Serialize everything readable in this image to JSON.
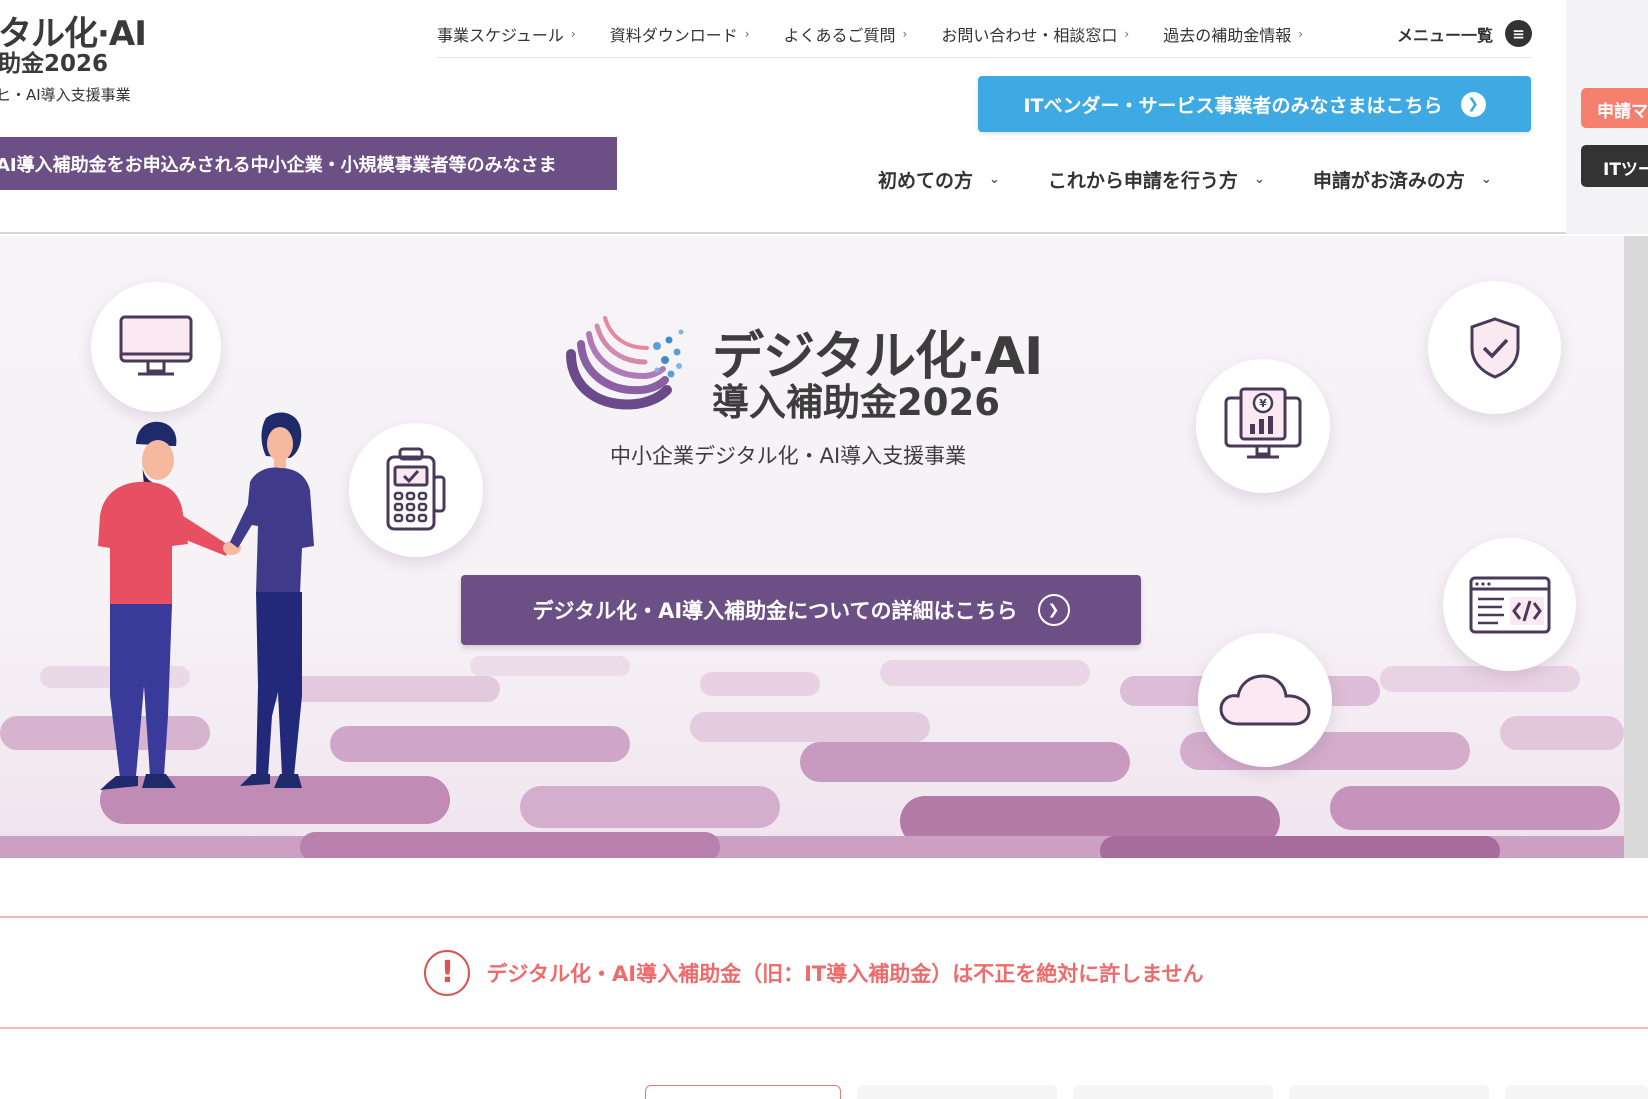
{
  "logo": {
    "line1": "タル化·AI",
    "line2": "助金2026",
    "line3": "ヒ・AI導入支援事業"
  },
  "util_nav": {
    "items": [
      {
        "label": "事業スケジュール"
      },
      {
        "label": "資料ダウンロード"
      },
      {
        "label": "よくあるご質問"
      },
      {
        "label": "お問い合わせ・相談窓口"
      },
      {
        "label": "過去の補助金情報"
      }
    ],
    "menu_label": "メニュー一覧"
  },
  "vendor_button": {
    "label": "ITベンダー・サービス事業者のみなさまはこちら"
  },
  "side_buttons": {
    "apply": "申請マ",
    "tool": "ITツー"
  },
  "audience_banner": {
    "label": "AI導入補助金をお申込みされる中小企業・小規模事業者等のみなさま"
  },
  "main_nav": {
    "items": [
      {
        "label": "初めての方"
      },
      {
        "label": "これから申請を行う方"
      },
      {
        "label": "申請がお済みの方"
      }
    ]
  },
  "hero": {
    "title_line1": "デジタル化·AI",
    "title_line2": "導入補助金2026",
    "subtitle": "中小企業デジタル化・AI導入支援事業",
    "detail_button": "デジタル化・AI導入補助金についての詳細はこちら"
  },
  "notice": {
    "text": "デジタル化・AI導入補助金（旧：IT導入補助金）は不正を絶対に許しません"
  },
  "colors": {
    "brand_purple": "#6c4f85",
    "vendor_blue": "#3ea9e2",
    "alert_red": "#ef6b6b",
    "apply_orange": "#f47f6e"
  },
  "icons": [
    "menu-icon",
    "monitor-icon",
    "payment-terminal-icon",
    "shield-check-icon",
    "yen-chart-monitor-icon",
    "code-window-icon",
    "cloud-icon",
    "alert-icon"
  ]
}
